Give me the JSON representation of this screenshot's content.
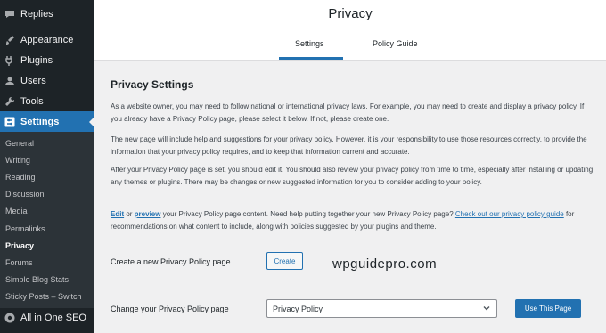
{
  "sidebar": {
    "items": [
      {
        "label": "Replies",
        "icon": "comment-icon"
      },
      {
        "label": "Appearance",
        "icon": "paintbrush-icon"
      },
      {
        "label": "Plugins",
        "icon": "plug-icon"
      },
      {
        "label": "Users",
        "icon": "user-icon"
      },
      {
        "label": "Tools",
        "icon": "wrench-icon"
      },
      {
        "label": "Settings",
        "icon": "settings-icon"
      }
    ],
    "submenu": [
      "General",
      "Writing",
      "Reading",
      "Discussion",
      "Media",
      "Permalinks",
      "Privacy",
      "Forums",
      "Simple Blog Stats",
      "Sticky Posts – Switch"
    ],
    "bottom_item": {
      "label": "All in One SEO",
      "icon": "aioseo-icon"
    }
  },
  "header": {
    "title": "Privacy",
    "tabs": [
      {
        "label": "Settings"
      },
      {
        "label": "Policy Guide"
      }
    ]
  },
  "main": {
    "heading": "Privacy Settings",
    "para1": "As a website owner, you may need to follow national or international privacy laws. For example, you may need to create and display a privacy policy. If you already have a Privacy Policy page, please select it below. If not, please create one.",
    "para2": "The new page will include help and suggestions for your privacy policy. However, it is your responsibility to use those resources correctly, to provide the information that your privacy policy requires, and to keep that information current and accurate.",
    "para3": "After your Privacy Policy page is set, you should edit it. You should also review your privacy policy from time to time, especially after installing or updating any themes or plugins. There may be changes or new suggested information for you to consider adding to your policy.",
    "para4": {
      "edit": "Edit",
      "or": " or ",
      "preview": "preview",
      "text1": " your Privacy Policy page content. Need help putting together your new Privacy Policy page? ",
      "guide_link": "Check out our privacy policy guide",
      "text2": " for recommendations on what content to include, along with policies suggested by your plugins and theme."
    },
    "create_label": "Create a new Privacy Policy page",
    "create_button": "Create",
    "change_label": "Change your Privacy Policy page",
    "select_value": "Privacy Policy",
    "use_button": "Use This Page"
  },
  "watermark": "wpguidepro.com",
  "colors": {
    "accent": "#2271b1",
    "sidebar_bg": "#1d2327",
    "submenu_bg": "#2c3338",
    "content_bg": "#f0f0f1"
  }
}
